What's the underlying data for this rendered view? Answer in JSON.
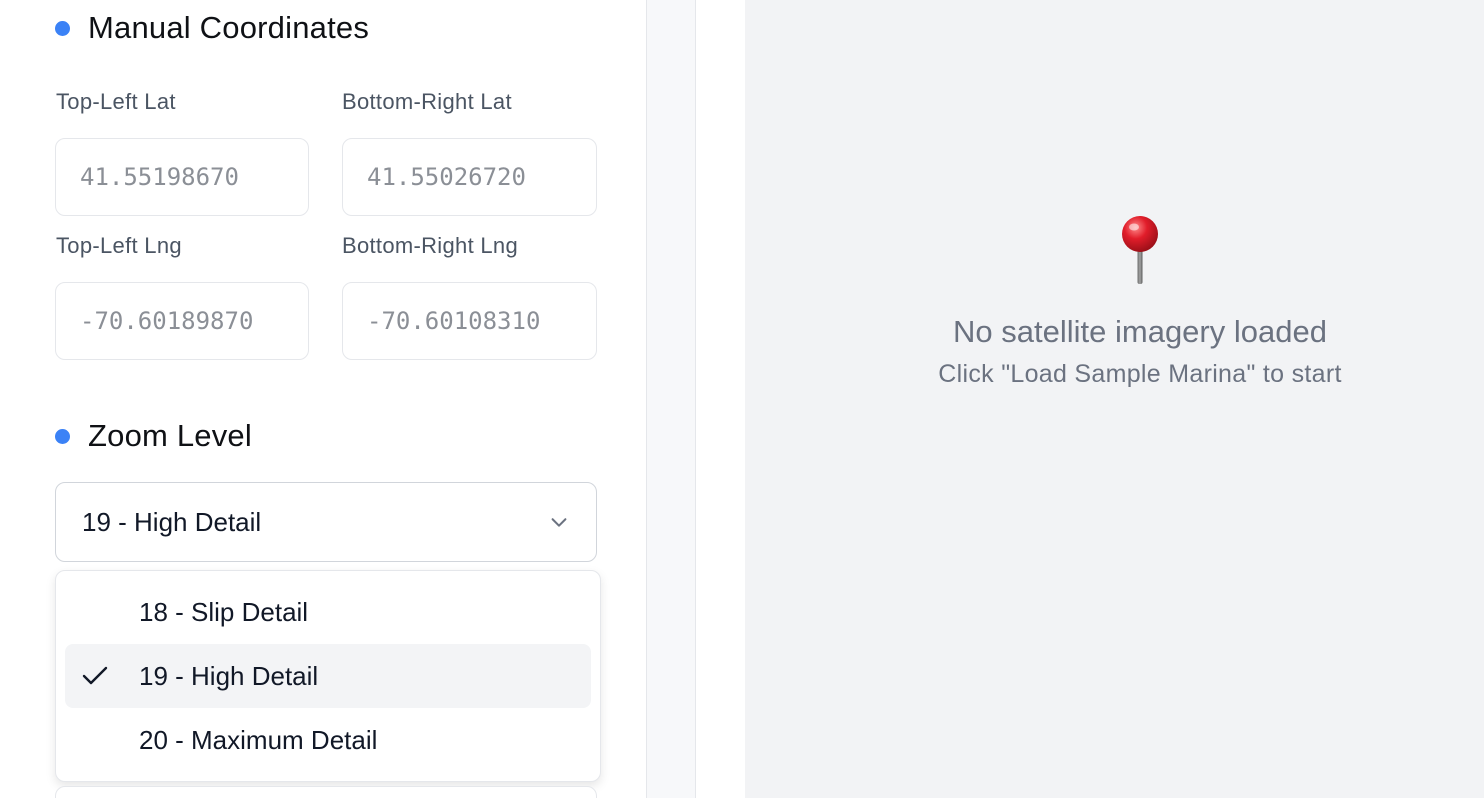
{
  "sections": {
    "coords_title": "Manual Coordinates",
    "zoom_title": "Zoom Level"
  },
  "coordinates": {
    "top_left_lat": {
      "label": "Top-Left Lat",
      "placeholder": "41.55198670"
    },
    "bottom_right_lat": {
      "label": "Bottom-Right Lat",
      "placeholder": "41.55026720"
    },
    "top_left_lng": {
      "label": "Top-Left Lng",
      "placeholder": "-70.60189870"
    },
    "bottom_right_lng": {
      "label": "Bottom-Right Lng",
      "placeholder": "-70.60108310"
    }
  },
  "zoom": {
    "selected": "19 - High Detail",
    "options": [
      {
        "label": "18 - Slip Detail",
        "selected": false
      },
      {
        "label": "19 - High Detail",
        "selected": true
      },
      {
        "label": "20 - Maximum Detail",
        "selected": false
      }
    ]
  },
  "map": {
    "empty_title": "No satellite imagery loaded",
    "empty_hint": "Click \"Load Sample Marina\" to start"
  },
  "icons": {
    "section_dot": "bullet-dot-icon",
    "chevron": "chevron-down-icon",
    "check": "checkmark-icon",
    "pin": "map-pin-icon"
  },
  "colors": {
    "accent": "#3b82f6",
    "map_bg": "#f2f3f5",
    "muted_text": "#6b7280",
    "pin_red": "#e11d2a"
  }
}
